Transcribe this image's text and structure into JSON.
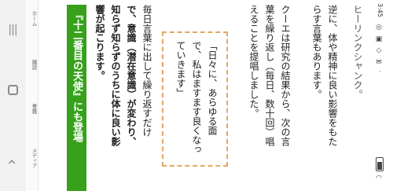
{
  "nav": {
    "recent_icon": "recent-apps-icon",
    "home_icon": "home-icon",
    "back_icon": "back-icon"
  },
  "tabs": {
    "home": "ホーム",
    "read": "購読",
    "book": "書籍",
    "media": "メディア"
  },
  "article": {
    "banner": "『十二番目の天使』にも登場",
    "col1": "響が起こります。",
    "col2": "知らず知らずのうちに体に良い影",
    "col3": "で、意識（潜在意識）が変わり、",
    "col4": "毎日言葉に出して繰り返すだけ",
    "callout1": "ていきます」",
    "callout2": "で、私はますます良くなっ",
    "callout3": "「日々に、あらゆる面",
    "col5": "えることを提唱しました。",
    "col6": "葉を繰り返し（毎日、数十回）唱",
    "col7": "クーエは研究の結果から、次の言",
    "col8": "らす言葉もあります。",
    "col9": "逆に、体や精神に良い影響をもた",
    "col10": "ヒーリンクシャンク。"
  },
  "status": {
    "time": "3:45",
    "icons": "◎ ▣ ◇ ✉ ·"
  }
}
